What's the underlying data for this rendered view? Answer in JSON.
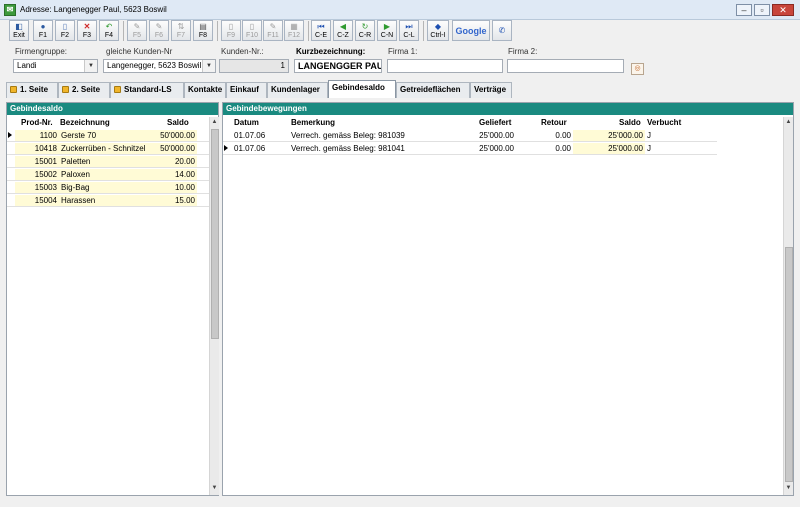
{
  "window": {
    "title": "Adresse: Langenegger Paul, 5623 Boswil",
    "app_icon": "address-app-icon"
  },
  "toolbar": [
    {
      "label": "Exit",
      "icon": "exit-icon",
      "enabled": true
    },
    {
      "label": "F1",
      "icon": "help-icon",
      "enabled": true
    },
    {
      "label": "F2",
      "icon": "new-document-icon",
      "enabled": true
    },
    {
      "label": "F3",
      "icon": "delete-icon",
      "enabled": true
    },
    {
      "label": "F4",
      "icon": "save-icon",
      "enabled": true
    },
    {
      "label": "F5",
      "icon": "tool-icon",
      "enabled": false
    },
    {
      "label": "F6",
      "icon": "tool-icon",
      "enabled": false
    },
    {
      "label": "F7",
      "icon": "sort-icon",
      "enabled": false
    },
    {
      "label": "F8",
      "icon": "print-icon",
      "enabled": true
    },
    {
      "label": "F9",
      "icon": "page-icon",
      "enabled": false
    },
    {
      "label": "F10",
      "icon": "page-icon",
      "enabled": false
    },
    {
      "label": "F11",
      "icon": "edit-icon",
      "enabled": false
    },
    {
      "label": "F12",
      "icon": "calc-icon",
      "enabled": false
    },
    {
      "label": "C-E",
      "icon": "nav-first-icon",
      "enabled": true
    },
    {
      "label": "C-Z",
      "icon": "nav-back-icon",
      "enabled": true
    },
    {
      "label": "C-R",
      "icon": "refresh-icon",
      "enabled": true
    },
    {
      "label": "C-N",
      "icon": "nav-next-icon",
      "enabled": true
    },
    {
      "label": "C-L",
      "icon": "nav-last-icon",
      "enabled": true
    },
    {
      "label": "Ctrl-I",
      "icon": "info-icon",
      "enabled": true
    }
  ],
  "google_label": "Google",
  "phone_icon": "phone-icon",
  "header": {
    "firmengruppe_label": "Firmengruppe:",
    "firmengruppe_value": "Landi",
    "gleiche_label": "gleiche Kunden-Nr",
    "gleiche_value": "Langenegger, 5623 Boswil",
    "kundennr_label": "Kunden-Nr.:",
    "kundennr_value": "1",
    "kurz_label": "Kurzbezeichnung:",
    "kurz_value": "LANGENGGER PAUL",
    "firma1_label": "Firma 1:",
    "firma1_value": "",
    "firma2_label": "Firma 2:",
    "firma2_value": ""
  },
  "tabs": [
    {
      "label": "1. Seite",
      "lock": true
    },
    {
      "label": "2. Seite",
      "lock": true
    },
    {
      "label": "Standard-LS",
      "lock": true
    },
    {
      "label": "Kontakte",
      "lock": false
    },
    {
      "label": "Einkauf",
      "lock": false
    },
    {
      "label": "Kundenlager",
      "lock": false
    },
    {
      "label": "Gebindesaldo",
      "lock": false
    },
    {
      "label": "Getreideflächen",
      "lock": false
    },
    {
      "label": "Verträge",
      "lock": false
    }
  ],
  "left_panel": {
    "title": "Gebindesaldo",
    "columns": [
      "Prod-Nr.",
      "Bezeichnung",
      "Saldo"
    ],
    "rows": [
      [
        "1100",
        "Gerste 70",
        "50'000.00"
      ],
      [
        "10418",
        "Zuckerrüben - Schnitzel",
        "50'000.00"
      ],
      [
        "15001",
        "Paletten",
        "20.00"
      ],
      [
        "15002",
        "Paloxen",
        "14.00"
      ],
      [
        "15003",
        "Big-Bag",
        "10.00"
      ],
      [
        "15004",
        "Harassen",
        "15.00"
      ]
    ]
  },
  "right_panel": {
    "title": "Gebindebewegungen",
    "columns": [
      "Datum",
      "Bemerkung",
      "Geliefert",
      "Retour",
      "Saldo",
      "Verbucht"
    ],
    "rows": [
      [
        "01.07.06",
        "Verrech. gemäss Beleg: 981039",
        "25'000.00",
        "0.00",
        "25'000.00",
        "J"
      ],
      [
        "01.07.06",
        "Verrech. gemäss Beleg: 981041",
        "25'000.00",
        "0.00",
        "25'000.00",
        "J"
      ]
    ]
  }
}
